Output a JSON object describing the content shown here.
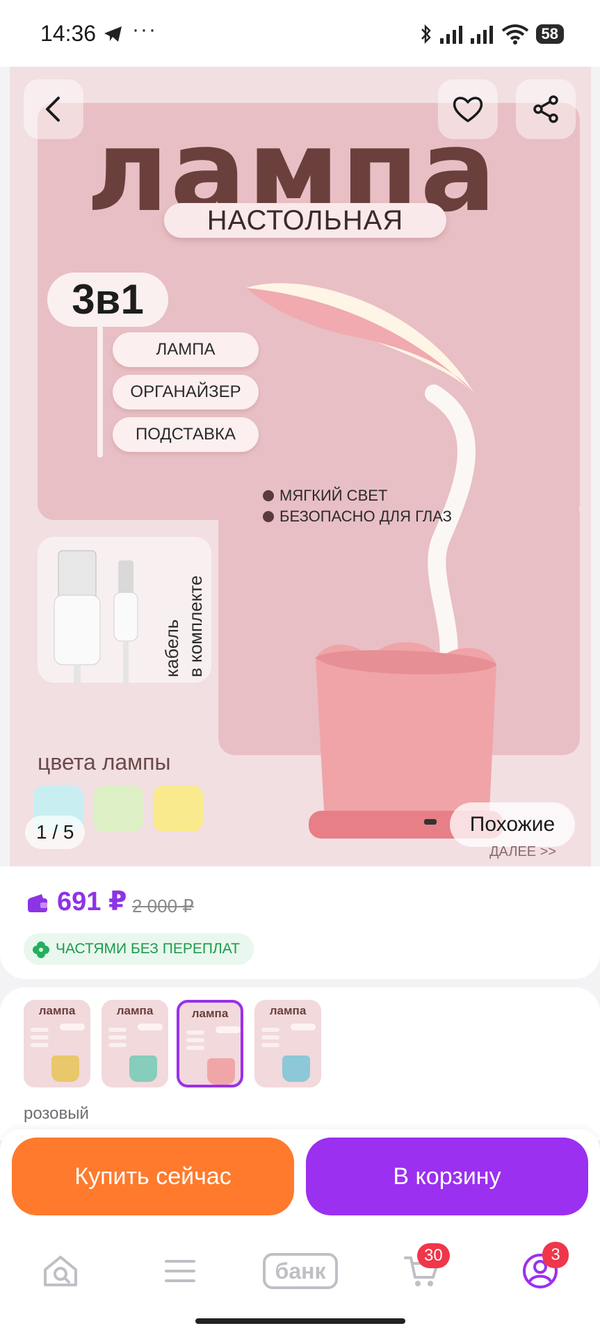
{
  "status_bar": {
    "time": "14:36",
    "battery": "58"
  },
  "product_image": {
    "title": "лампа",
    "subtitle": "НАСТОЛЬНАЯ",
    "badge": "3в1",
    "features": [
      "ЛАМПА",
      "ОРГАНАЙЗЕР",
      "ПОДСТАВКА"
    ],
    "bullets": [
      "МЯГКИЙ СВЕТ",
      "БЕЗОПАСНО ДЛЯ ГЛАЗ"
    ],
    "cable_label": "кабель в комплекте",
    "colors_title": "цвета лампы",
    "swatch_colors": [
      "#c9eef2",
      "#def0c6",
      "#faea8e"
    ],
    "counter": "1 / 5",
    "similar_button": "Похожие",
    "next_hint": "ДАЛЕЕ >>"
  },
  "price": {
    "current": "691 ₽",
    "old": "2 000 ₽",
    "installments": "ЧАСТЯМИ БЕЗ ПЕРЕПЛАТ"
  },
  "variants": {
    "thumbs": [
      {
        "title": "лампа",
        "color": "#e8c86a",
        "selected": false
      },
      {
        "title": "лампа",
        "color": "#86cdbb",
        "selected": false
      },
      {
        "title": "лампа",
        "color": "#f0a6a6",
        "selected": true
      },
      {
        "title": "лампа",
        "color": "#8cc8d8",
        "selected": false
      }
    ],
    "selected_label": "розовый"
  },
  "actions": {
    "buy_now": "Купить сейчас",
    "add_to_cart": "В корзину"
  },
  "bottom_nav": {
    "bank_label": "банк",
    "cart_count": "30",
    "profile_count": "3"
  },
  "colors": {
    "accent": "#9b30f0",
    "buy": "#ff7a2c",
    "badge": "#f0364a",
    "green": "#1c9b4e"
  }
}
